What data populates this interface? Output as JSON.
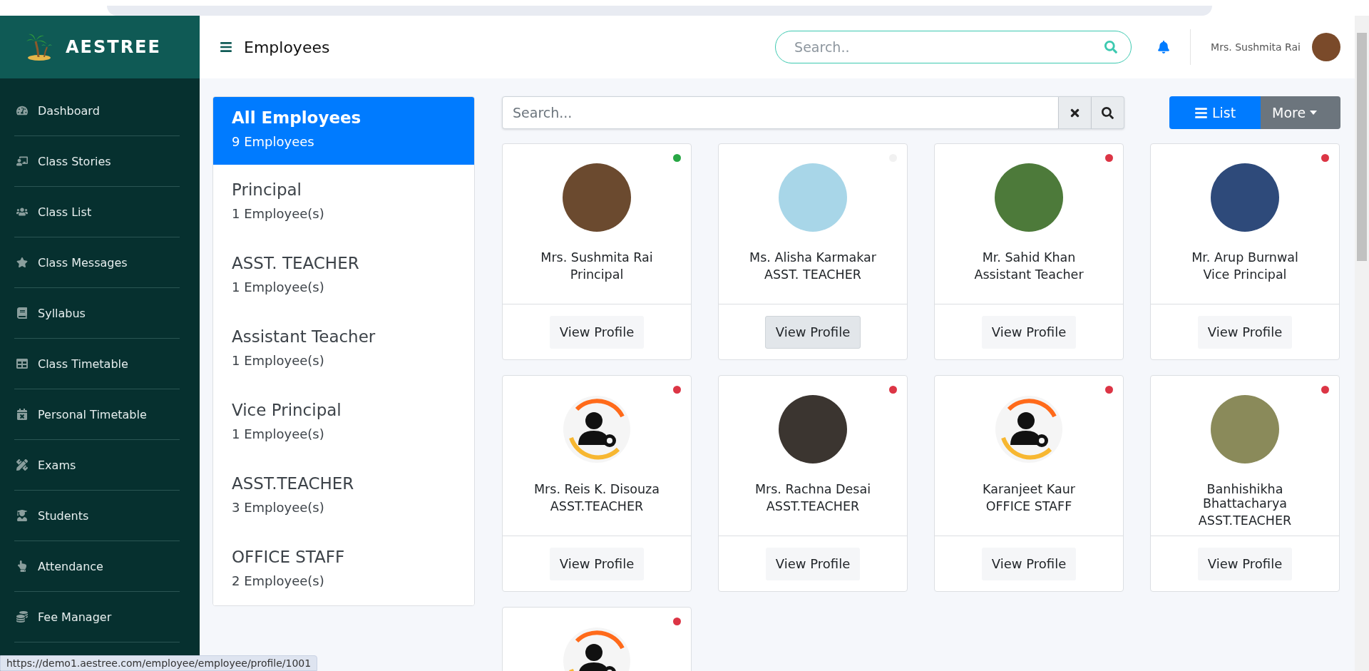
{
  "brand": {
    "name": "AESTREE"
  },
  "header": {
    "title": "Employees",
    "search": {
      "placeholder": "Search.."
    },
    "user": {
      "name": "Mrs. Sushmita Rai"
    }
  },
  "sidebar": {
    "items": [
      {
        "label": "Dashboard"
      },
      {
        "label": "Class Stories"
      },
      {
        "label": "Class List"
      },
      {
        "label": "Class Messages"
      },
      {
        "label": "Syllabus"
      },
      {
        "label": "Class Timetable"
      },
      {
        "label": "Personal Timetable"
      },
      {
        "label": "Exams"
      },
      {
        "label": "Students"
      },
      {
        "label": "Attendance"
      },
      {
        "label": "Fee Manager"
      }
    ]
  },
  "categories": [
    {
      "title": "All Employees",
      "count": "9 Employees",
      "selected": true
    },
    {
      "title": "Principal",
      "count": "1 Employee(s)",
      "selected": false
    },
    {
      "title": "ASST. TEACHER",
      "count": "1 Employee(s)",
      "selected": false
    },
    {
      "title": "Assistant Teacher",
      "count": "1 Employee(s)",
      "selected": false
    },
    {
      "title": "Vice Principal",
      "count": "1 Employee(s)",
      "selected": false
    },
    {
      "title": "ASST.TEACHER",
      "count": "3 Employee(s)",
      "selected": false
    },
    {
      "title": "OFFICE STAFF",
      "count": "2 Employee(s)",
      "selected": false
    }
  ],
  "toolbar": {
    "search": {
      "placeholder": "Search..."
    },
    "view_buttons": [
      {
        "label": "List",
        "kind": "list",
        "selected": true
      },
      {
        "label": "More",
        "kind": "dropdown",
        "selected": false
      }
    ]
  },
  "employees": [
    {
      "name": "Mrs. Sushmita Rai",
      "role": "Principal",
      "color": "#28a745",
      "kind": "photo",
      "button": "View Profile",
      "hovered": false
    },
    {
      "name": "Ms. Alisha Karmakar",
      "role": "ASST. TEACHER",
      "color": "#f1f1f1",
      "kind": "photo",
      "button": "View Profile",
      "hovered": true
    },
    {
      "name": "Mr. Sahid Khan",
      "role": "Assistant Teacher",
      "color": "#dc3545",
      "kind": "photo",
      "button": "View Profile",
      "hovered": false
    },
    {
      "name": "Mr. Arup Burnwal",
      "role": "Vice Principal",
      "color": "#dc3545",
      "kind": "photo",
      "button": "View Profile",
      "hovered": false
    },
    {
      "name": "Mrs. Reis K. Disouza",
      "role": "ASST.TEACHER",
      "color": "#dc3545",
      "kind": "generic",
      "button": "View Profile",
      "hovered": false
    },
    {
      "name": "Mrs. Rachna Desai",
      "role": "ASST.TEACHER",
      "color": "#dc3545",
      "kind": "photo",
      "button": "View Profile",
      "hovered": false
    },
    {
      "name": "Karanjeet Kaur",
      "role": "OFFICE STAFF",
      "color": "#dc3545",
      "kind": "generic",
      "button": "View Profile",
      "hovered": false
    },
    {
      "name": "Banhishikha Bhattacharya",
      "role": "ASST.TEACHER",
      "color": "#dc3545",
      "kind": "photo",
      "button": "View Profile",
      "hovered": false
    },
    {
      "color": "#dc3545",
      "kind": "generic"
    }
  ],
  "status_url": "https://demo1.aestree.com/employee/employee/profile/1001"
}
